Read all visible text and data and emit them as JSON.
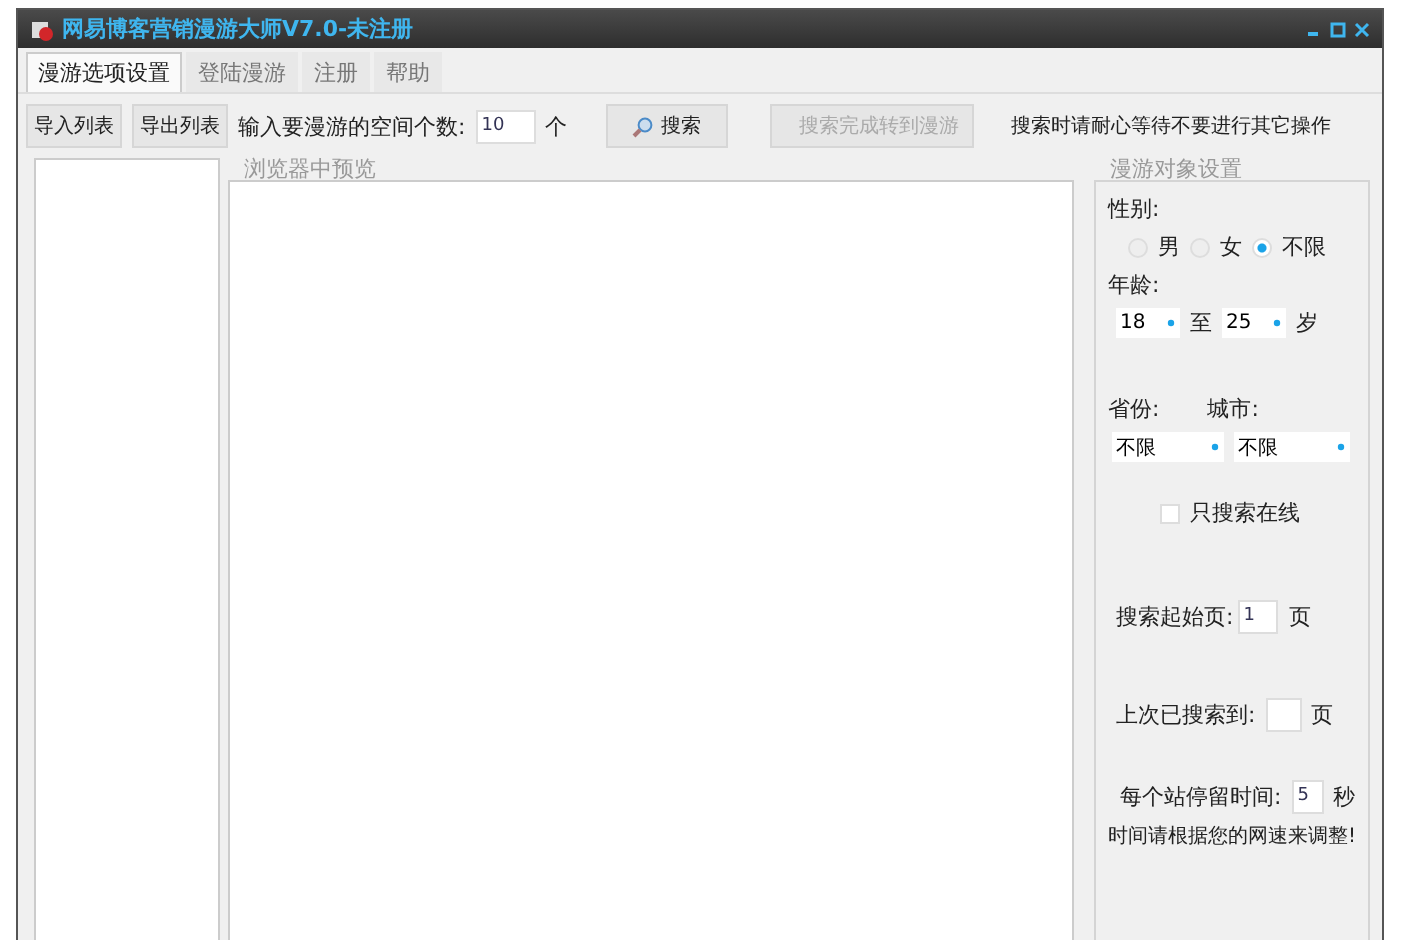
{
  "window": {
    "title": "网易博客营销漫游大师V7.0-未注册"
  },
  "tabs": [
    {
      "label": "漫游选项设置",
      "selected": true
    },
    {
      "label": "登陆漫游",
      "selected": false
    },
    {
      "label": "注册",
      "selected": false
    },
    {
      "label": "帮助",
      "selected": false
    }
  ],
  "toolbar": {
    "import_button": "导入列表",
    "export_button": "导出列表",
    "count_label": "输入要漫游的空间个数:",
    "count_value": "10",
    "count_unit": "个",
    "search_button": "搜索",
    "transfer_button": {
      "label": "搜索完成转到漫游",
      "disabled": true
    },
    "notice": "搜索时请耐心等待不要进行其它操作"
  },
  "preview": {
    "title": "浏览器中预览"
  },
  "settings": {
    "title": "漫游对象设置",
    "gender_label": "性别:",
    "gender_options": [
      {
        "label": "男",
        "selected": false
      },
      {
        "label": "女",
        "selected": false
      },
      {
        "label": "不限",
        "selected": true
      }
    ],
    "age_label": "年龄:",
    "age_from": "18",
    "age_to_label": "至",
    "age_to": "25",
    "age_unit": "岁",
    "province_label": "省份:",
    "city_label": "城市:",
    "province_value": "不限",
    "city_value": "不限",
    "online_only": {
      "label": "只搜索在线",
      "checked": false
    },
    "start_page_label": "搜索起始页:",
    "start_page_value": "1",
    "start_page_unit": "页",
    "last_page_label": "上次已搜索到:",
    "last_page_unit": "页",
    "stay_label": "每个站停留时间:",
    "stay_value": "5",
    "stay_unit": "秒",
    "hint": "时间请根据您的网速来调整!"
  }
}
